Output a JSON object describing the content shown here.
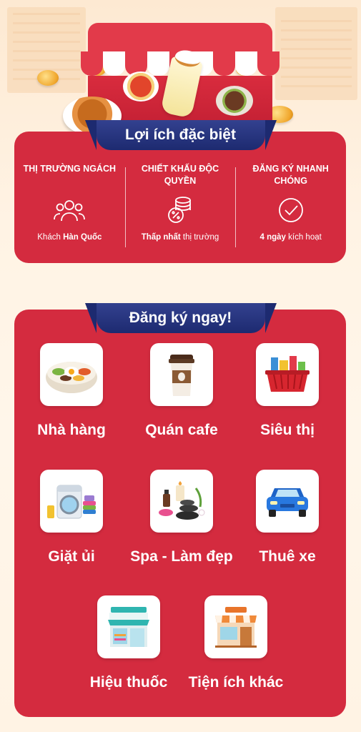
{
  "section_benefits": {
    "title": "Lợi ích đặc biệt",
    "items": [
      {
        "title": "THỊ TRƯỜNG NGÁCH",
        "icon": "users-icon",
        "desc_pre": "Khách ",
        "desc_bold": "Hàn Quốc",
        "desc_post": ""
      },
      {
        "title": "CHIẾT KHẤU ĐỘC QUYỀN",
        "icon": "discount-coins-icon",
        "desc_pre": "",
        "desc_bold": "Thấp nhất",
        "desc_post": " thị trường"
      },
      {
        "title": "ĐĂNG KÝ NHANH CHÓNG",
        "icon": "check-circle-icon",
        "desc_pre": "",
        "desc_bold": "4 ngày",
        "desc_post": " kích hoạt"
      }
    ]
  },
  "section_register": {
    "title": "Đăng ký ngay!",
    "categories": [
      {
        "label": "Nhà hàng",
        "icon": "bibimbap-icon"
      },
      {
        "label": "Quán cafe",
        "icon": "coffee-cup-icon"
      },
      {
        "label": "Siêu thị",
        "icon": "grocery-basket-icon"
      },
      {
        "label": "Giặt ủi",
        "icon": "washing-machine-icon"
      },
      {
        "label": "Spa - Làm đẹp",
        "icon": "spa-stones-icon"
      },
      {
        "label": "Thuê xe",
        "icon": "car-icon"
      },
      {
        "label": "Hiệu thuốc",
        "icon": "pharmacy-store-icon"
      },
      {
        "label": "Tiện ích khác",
        "icon": "store-icon"
      }
    ]
  },
  "colors": {
    "panel": "#d42b3f",
    "ribbon": "#1d2a70",
    "background": "#fff3e4"
  }
}
